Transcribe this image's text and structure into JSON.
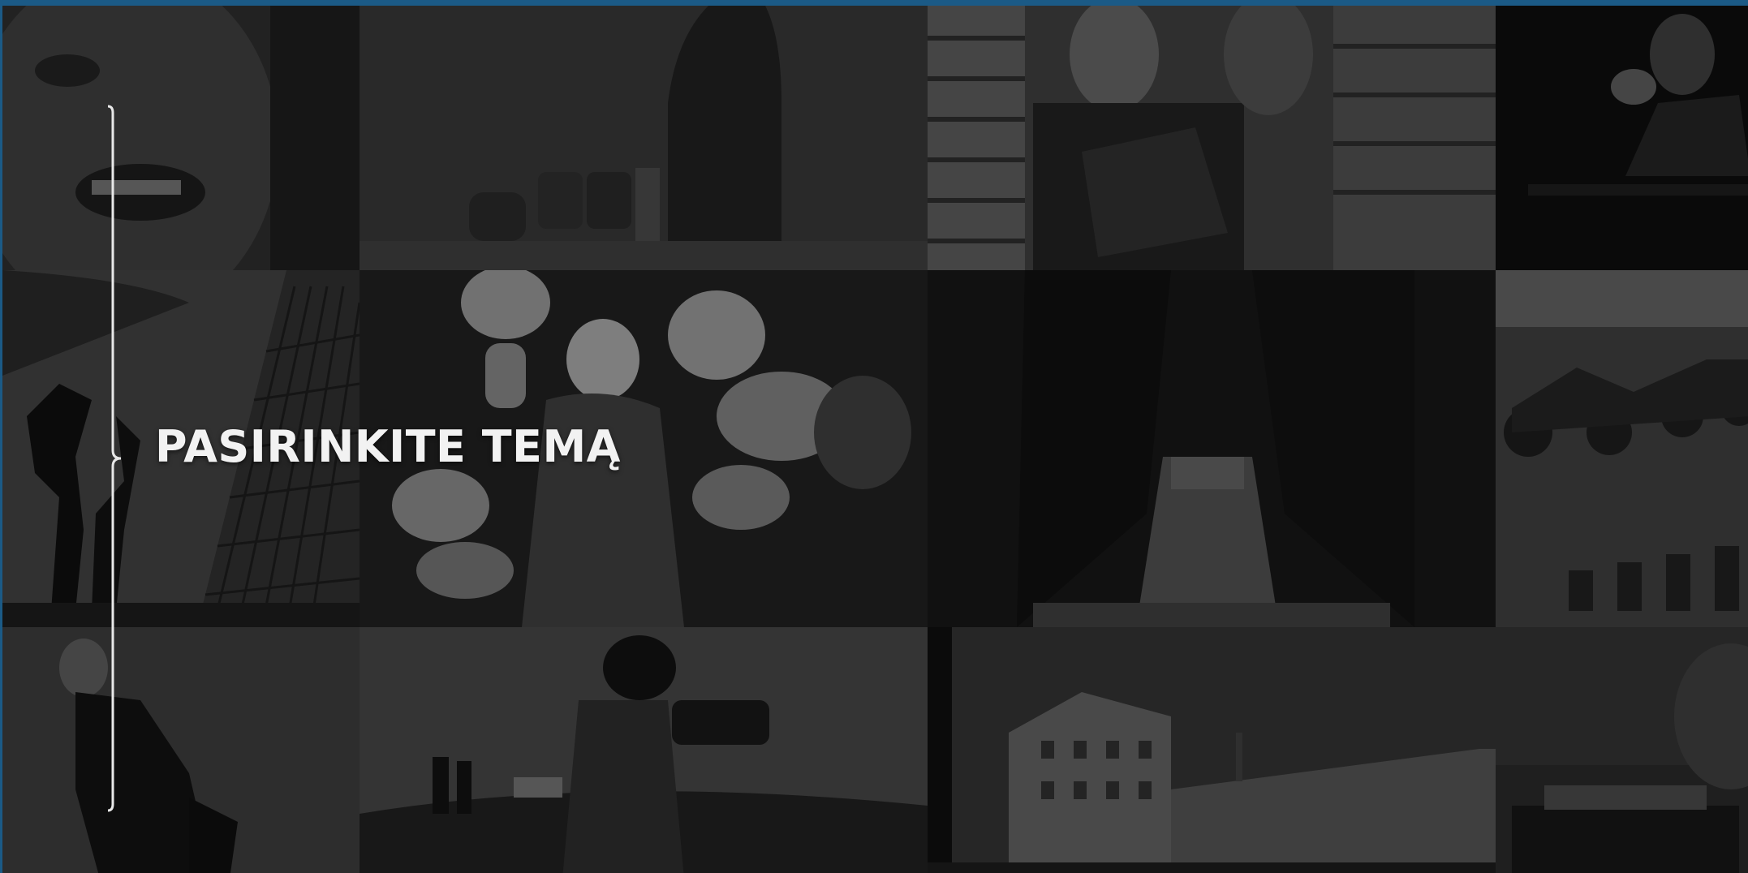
{
  "header": {
    "title": "PASIRINKITE TEMĄ"
  },
  "tiles": [
    {
      "id": "face-closeup",
      "icon": "face-photo"
    },
    {
      "id": "ceramics",
      "icon": "vase-photo"
    },
    {
      "id": "reader-books",
      "icon": "book-reader-photo"
    },
    {
      "id": "performer",
      "icon": "performer-photo"
    },
    {
      "id": "ballet-net",
      "icon": "ballet-photo"
    },
    {
      "id": "puppets",
      "icon": "puppet-photo"
    },
    {
      "id": "stage",
      "icon": "stage-photo"
    },
    {
      "id": "motorcycles",
      "icon": "motorcycle-photo"
    },
    {
      "id": "old-man",
      "icon": "man-photo"
    },
    {
      "id": "cameraman",
      "icon": "camera-photo"
    },
    {
      "id": "buildings",
      "icon": "building-photo"
    },
    {
      "id": "table",
      "icon": "table-photo"
    }
  ],
  "colors": {
    "frame": "#1b5a86",
    "heading": "#f2f2f2",
    "bracket": "#e8e8e8"
  }
}
